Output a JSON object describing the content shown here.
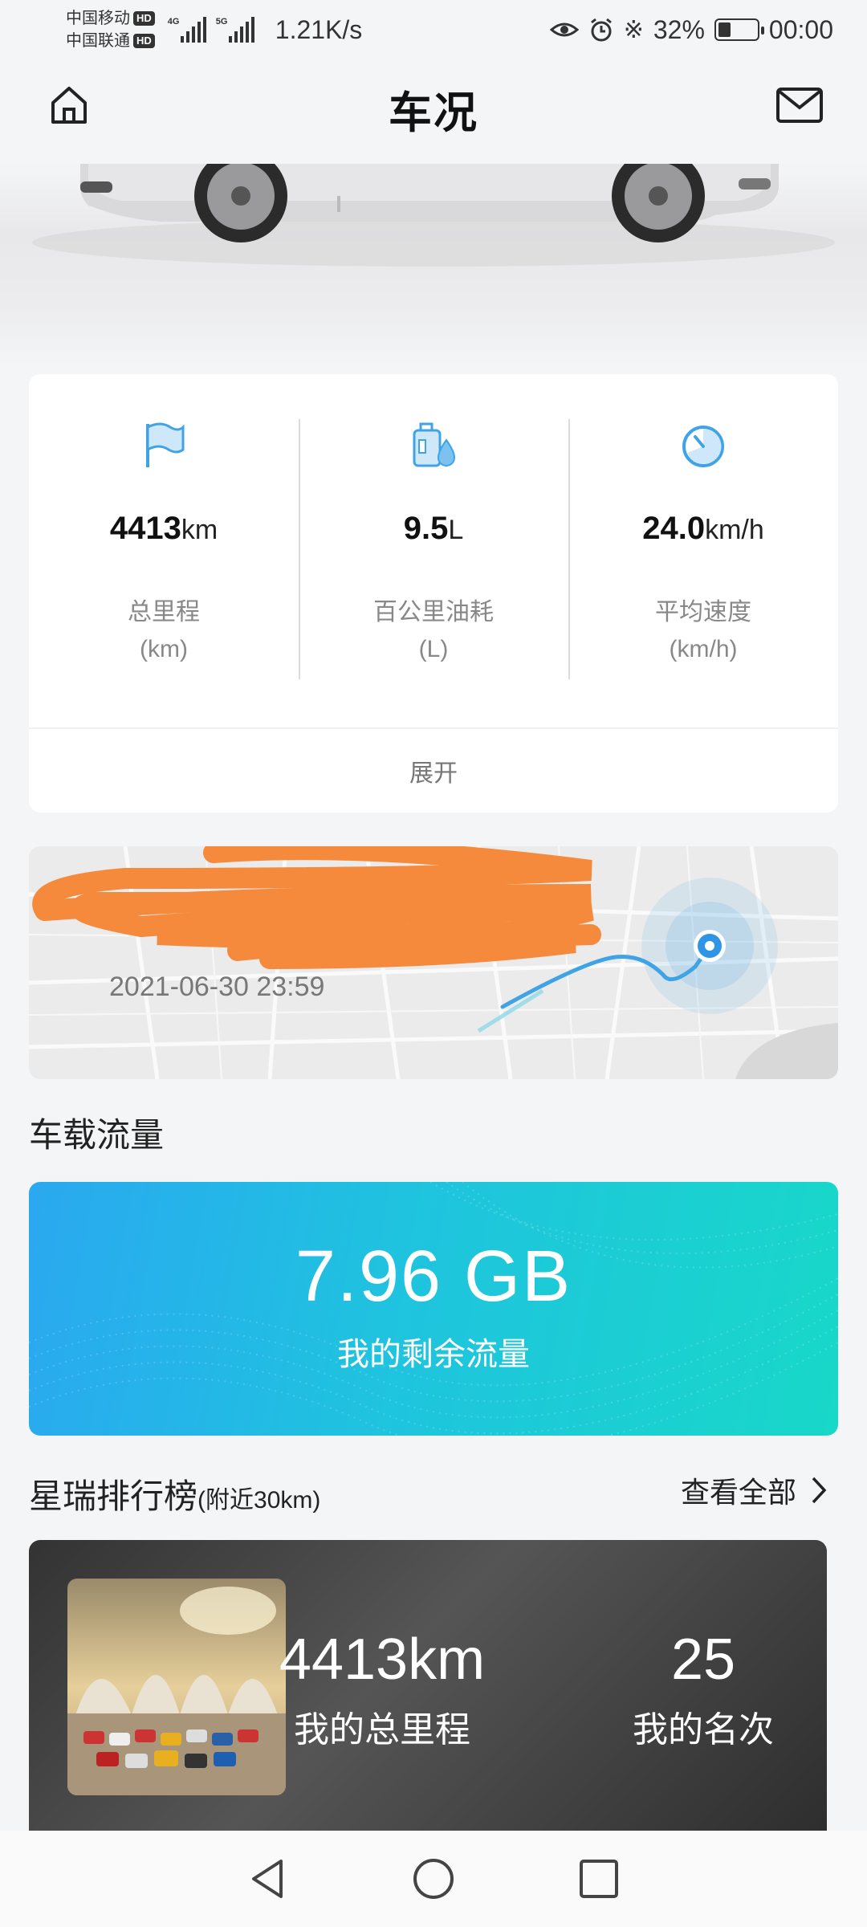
{
  "status_bar": {
    "carrier1": "中国移动",
    "carrier2": "中国联通",
    "hd": "HD",
    "net1": "4G",
    "net2": "5G",
    "speed": "1.21K/s",
    "battery": "32%",
    "battery_level": 0.32,
    "time": "00:00"
  },
  "header": {
    "title": "车况"
  },
  "stats": [
    {
      "value": "4413",
      "unit": "km",
      "label": "总里程",
      "sub": "(km)",
      "icon": "flag-icon"
    },
    {
      "value": "9.5",
      "unit": "L",
      "label": "百公里油耗",
      "sub": "(L)",
      "icon": "oil-icon"
    },
    {
      "value": "24.0",
      "unit": "km/h",
      "label": "平均速度",
      "sub": "(km/h)",
      "icon": "speedometer-icon"
    }
  ],
  "expand_label": "展开",
  "map": {
    "timestamp": "2021-06-30 23:59"
  },
  "data_section": {
    "title": "车载流量",
    "value": "7.96 GB",
    "label": "我的剩余流量"
  },
  "ranking": {
    "title": "星瑞排行榜",
    "subtitle": "(附近30km)",
    "view_all": "查看全部",
    "mileage_value": "4413km",
    "mileage_label": "我的总里程",
    "rank_value": "25",
    "rank_label": "我的名次"
  },
  "colors": {
    "accent": "#3fa3e6",
    "data_card_start": "#2aa8f0",
    "data_card_end": "#18d8c8",
    "scribble": "#f58a3c"
  }
}
